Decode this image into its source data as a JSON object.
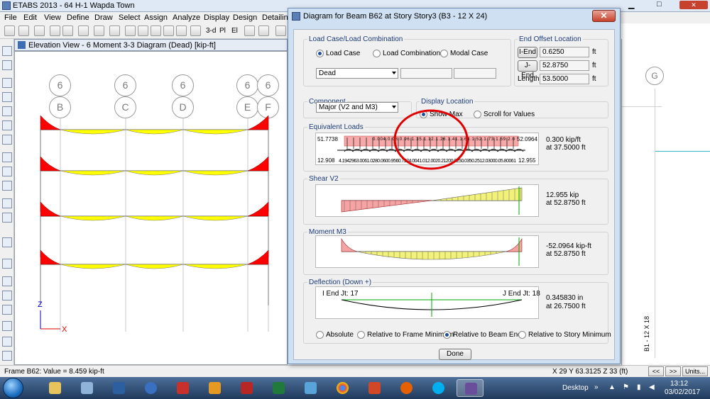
{
  "app": {
    "title": "ETABS 2013  - 64 H-1 Wapda Town",
    "menu": [
      "File",
      "Edit",
      "View",
      "Define",
      "Draw",
      "Select",
      "Assign",
      "Analyze",
      "Display",
      "Design",
      "Detailing"
    ],
    "toolbar": {
      "view_3d": "3-d",
      "plan": "Pl",
      "elev": "El"
    }
  },
  "view_window": {
    "tab_title": "Elevation View - 6    Moment 3-3 Diagram    (Dead)  [kip-ft]",
    "grid_top": [
      "6",
      "6",
      "6",
      "6",
      "6"
    ],
    "grid_bottom": [
      "B",
      "C",
      "D",
      "E",
      "F"
    ],
    "axis_x": "X",
    "axis_z": "Z"
  },
  "right_pane": {
    "grid_label": "G",
    "beam_label": "B1 - 12 X 18"
  },
  "dialog": {
    "title": "Diagram for Beam B62 at Story Story3 (B3 - 12 X 24)",
    "close": "✕",
    "load_case": {
      "group_label": "Load Case/Load Combination",
      "options": [
        "Load Case",
        "Load Combination",
        "Modal Case"
      ],
      "selected": "Dead"
    },
    "end_offset": {
      "group_label": "End Offset Location",
      "i_end_label": "I-End",
      "i_end_value": "0.6250",
      "j_end_label": "J-End",
      "j_end_value": "52.8750",
      "length_label": "Length",
      "length_value": "53.5000",
      "unit": "ft"
    },
    "component": {
      "group_label": "Component",
      "selected": "Major (V2 and M3)"
    },
    "display_location": {
      "group_label": "Display Location",
      "show_max": "Show Max",
      "scroll": "Scroll for Values"
    },
    "equivalent_loads": {
      "group_label": "Equivalent Loads",
      "left_top": "51.7738",
      "right_top": "52.0964",
      "left_bottom": "12.908",
      "right_bottom": "12.955",
      "mid_values": "4.1942963.0061.0280.0600.9560.7224.0041.012.0020.21200.0250.0350.2512.03000.05.80061",
      "top_values": "0.004.0.08.0.96.1.35.1.12.1.26.1.41.1.63.1.52.1.73.1.59.2.0",
      "value": "0.300 kip/ft",
      "at": "at 37.5000 ft"
    },
    "shear": {
      "group_label": "Shear V2",
      "value": "12.955 kip",
      "at": "at 52.8750 ft"
    },
    "moment": {
      "group_label": "Moment M3",
      "value": "-52.0964 kip-ft",
      "at": "at 52.8750 ft"
    },
    "deflection": {
      "group_label": "Deflection (Down +)",
      "i_end": "I End Jt: 17",
      "j_end": "J End Jt: 18",
      "value": "0.345830 in",
      "at": "at 26.7500 ft",
      "options": [
        "Absolute",
        "Relative to Frame Minimum",
        "Relative to Beam Ends",
        "Relative to Story Minimum"
      ]
    },
    "done": "Done"
  },
  "status": {
    "left": "Frame B62:  Value = 8.459 kip-ft",
    "coords": "X 29  Y 63.3125  Z 33 (ft)",
    "prev": "<<",
    "next": ">>",
    "units": "Units..."
  },
  "taskbar": {
    "desktop": "Desktop",
    "time": "13:12",
    "date": "03/02/2017"
  },
  "colors": {
    "moment_positive": "#ffff00",
    "moment_negative": "#ff0000",
    "deflection": "#00aa00",
    "annotation_circle": "#e00000"
  }
}
